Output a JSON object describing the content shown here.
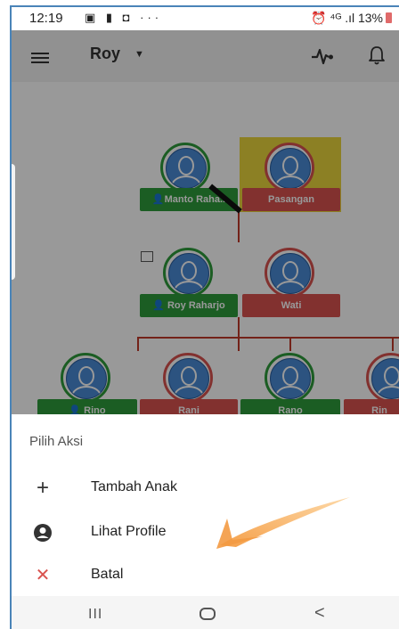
{
  "status_bar": {
    "time": "12:19",
    "left_icons": "▣ ▮ ◘ ···",
    "right": "⏰ ⁴ᴳ .ıl 13%"
  },
  "app_bar": {
    "title": "Roy",
    "caret": "▼"
  },
  "tree": {
    "row1": [
      {
        "name": "Manto Raha..",
        "prefix": "👤",
        "gender": "male"
      },
      {
        "name": "Pasangan",
        "prefix": "",
        "gender": "female",
        "highlighted": true
      }
    ],
    "row2": [
      {
        "name": "Roy Raharjo",
        "prefix": "👤",
        "gender": "male"
      },
      {
        "name": "Wati",
        "prefix": "",
        "gender": "female"
      }
    ],
    "row3": [
      {
        "name": "Rino",
        "prefix": "👤",
        "gender": "male"
      },
      {
        "name": "Rani",
        "prefix": "",
        "gender": "female"
      },
      {
        "name": "Rano",
        "prefix": "",
        "gender": "male"
      },
      {
        "name": "Rin",
        "prefix": "",
        "gender": "female"
      }
    ]
  },
  "sheet": {
    "title": "Pilih Aksi",
    "actions": [
      {
        "icon": "plus-icon",
        "glyph": "+",
        "label": "Tambah Anak",
        "color": "#333333"
      },
      {
        "icon": "account-circle-icon",
        "glyph": "",
        "label": "Lihat Profile",
        "color": "#333333"
      },
      {
        "icon": "close-icon",
        "glyph": "✕",
        "label": "Batal",
        "color": "#d9534f"
      }
    ]
  },
  "nav_bar": {
    "recent": "III",
    "back": "<"
  },
  "colors": {
    "male": "#2e9b3b",
    "female": "#d9534f",
    "highlight": "#e9d63c",
    "line": "#c0392b"
  }
}
